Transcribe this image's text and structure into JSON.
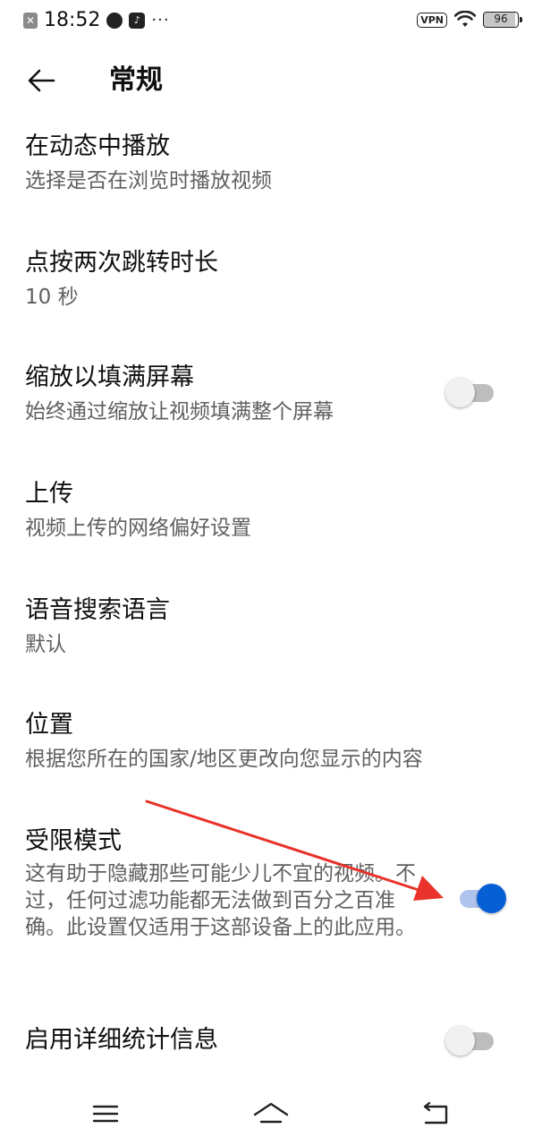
{
  "status_bar": {
    "time": "18:52",
    "vpn_label": "VPN",
    "battery_level": "96",
    "more_indicator": "···"
  },
  "header": {
    "title": "常规"
  },
  "settings": [
    {
      "title": "在动态中播放",
      "subtitle": "选择是否在浏览时播放视频"
    },
    {
      "title": "点按两次跳转时长",
      "subtitle": "10 秒"
    },
    {
      "title": "缩放以填满屏幕",
      "subtitle": "始终通过缩放让视频填满整个屏幕",
      "toggle": false
    },
    {
      "title": "上传",
      "subtitle": "视频上传的网络偏好设置"
    },
    {
      "title": "语音搜索语言",
      "subtitle": "默认"
    },
    {
      "title": "位置",
      "subtitle": "根据您所在的国家/地区更改向您显示的内容"
    },
    {
      "title": "受限模式",
      "subtitle": "这有助于隐藏那些可能少儿不宜的视频。不过，任何过滤功能都无法做到百分之百准确。此设置仅适用于这部设备上的此应用。",
      "toggle": true
    },
    {
      "title": "启用详细统计信息",
      "toggle": false
    }
  ],
  "colors": {
    "accent": "#065fd4",
    "annotation_arrow": "#e8322b",
    "subtitle_text": "#606060"
  },
  "icons": {
    "back": "arrow-left-icon",
    "nav_menu": "menu-icon",
    "nav_home": "home-icon",
    "nav_back": "back-icon"
  }
}
